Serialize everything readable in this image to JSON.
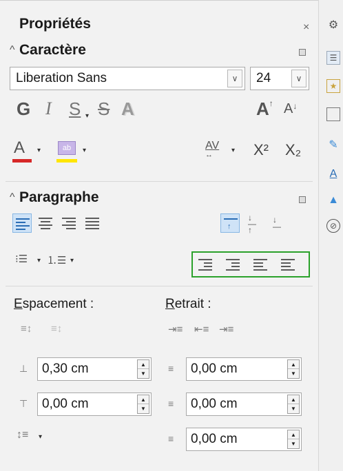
{
  "panel": {
    "title": "Propriétés",
    "close_symbol": "×"
  },
  "caractere": {
    "header": "Caractère",
    "font_name": "Liberation Sans",
    "font_size": "24",
    "bold": "G",
    "italic": "I",
    "underline": "S",
    "strike": "S",
    "shadow": "A",
    "grow": "A",
    "shrink": "A",
    "font_color": "A",
    "spacing": "AV",
    "superscript": "X²",
    "subscript": "X₂"
  },
  "paragraphe": {
    "header": "Paragraphe"
  },
  "espacement": {
    "label": "Espacement :",
    "above_value": "0,30 cm",
    "below_value": "0,00 cm"
  },
  "retrait": {
    "label": "Retrait :",
    "before_value": "0,00 cm",
    "after_value": "0,00 cm",
    "first_line_value": "0,00 cm"
  },
  "colors": {
    "font_color_bar": "#d62828",
    "highlight_bar": "#ffe600",
    "active_blue": "#cfe3f7",
    "green_outline": "#2aa12a"
  }
}
